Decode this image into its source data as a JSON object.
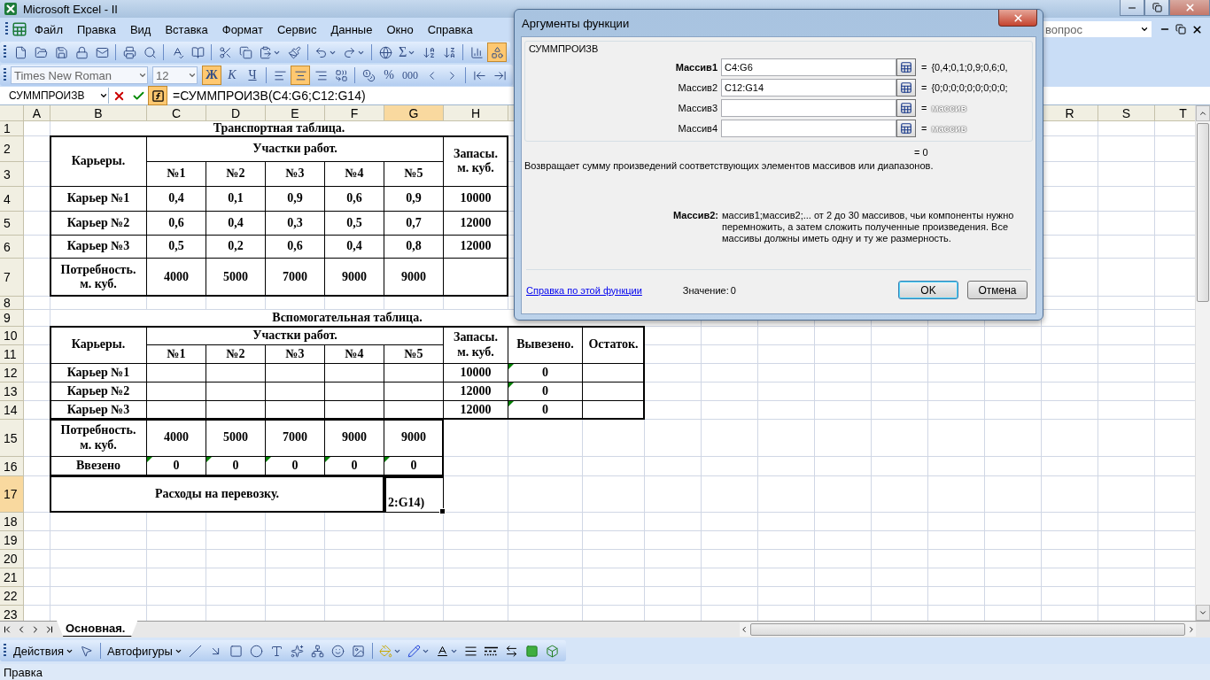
{
  "window": {
    "title": "Microsoft Excel - II"
  },
  "menu": [
    "Файл",
    "Правка",
    "Вид",
    "Вставка",
    "Формат",
    "Сервис",
    "Данные",
    "Окно",
    "Справка"
  ],
  "help_box": {
    "placeholder": "вопрос"
  },
  "standard_toolbar": [
    {
      "kind": "new",
      "on": false
    },
    {
      "kind": "open",
      "on": false
    },
    {
      "kind": "save",
      "on": false
    },
    {
      "kind": "permission",
      "on": false
    },
    {
      "kind": "email",
      "on": false
    },
    {
      "kind": "print",
      "on": false
    },
    {
      "kind": "preview",
      "on": false
    },
    {
      "kind": "spelling",
      "on": false
    },
    {
      "kind": "research",
      "on": false
    },
    {
      "kind": "cut",
      "on": false
    },
    {
      "kind": "copy",
      "on": false
    },
    {
      "kind": "paste",
      "on": false
    },
    {
      "kind": "painter",
      "on": false
    },
    {
      "kind": "undo",
      "on": false
    },
    {
      "kind": "redo",
      "on": false
    },
    {
      "kind": "hyperlink",
      "on": false
    },
    {
      "kind": "autosum",
      "label": "Σ",
      "on": false
    },
    {
      "kind": "sort-asc",
      "on": false
    },
    {
      "kind": "sort-desc",
      "on": false
    },
    {
      "kind": "chart",
      "on": false
    },
    {
      "kind": "drawing",
      "on": true
    }
  ],
  "formatting_toolbar": {
    "font": "Times New Roman",
    "size": "12",
    "buttons": [
      {
        "kind": "bold",
        "label": "Ж",
        "on": true
      },
      {
        "kind": "italic",
        "label": "К",
        "on": false
      },
      {
        "kind": "underline",
        "label": "Ч",
        "on": false
      },
      {
        "kind": "align-left",
        "on": false
      },
      {
        "kind": "align-center",
        "on": true
      },
      {
        "kind": "align-right",
        "on": false
      },
      {
        "kind": "merge",
        "on": false
      },
      {
        "kind": "currency",
        "on": false
      },
      {
        "kind": "percent",
        "label": "%",
        "on": false
      },
      {
        "kind": "thousands",
        "label": "000",
        "on": false
      },
      {
        "kind": "inc-decimal",
        "on": false
      },
      {
        "kind": "dec-decimal",
        "on": false
      },
      {
        "kind": "outdent",
        "on": false
      },
      {
        "kind": "indent",
        "on": false
      }
    ]
  },
  "formula_bar": {
    "name_box": "СУММПРОИЗВ",
    "formula": "=СУММПРОИЗВ(C4:G6;C12:G14)"
  },
  "column_headers": [
    {
      "label": "A",
      "selected": false
    },
    {
      "label": "B",
      "selected": false
    },
    {
      "label": "C",
      "selected": false
    },
    {
      "label": "D",
      "selected": false
    },
    {
      "label": "E",
      "selected": false
    },
    {
      "label": "F",
      "selected": false
    },
    {
      "label": "G",
      "selected": true
    },
    {
      "label": "H",
      "selected": false
    },
    {
      "label": "R",
      "selected": false
    },
    {
      "label": "S",
      "selected": false
    },
    {
      "label": "T",
      "selected": false
    }
  ],
  "row_numbers": [
    {
      "label": "1",
      "selected": false
    },
    {
      "label": "2",
      "selected": false
    },
    {
      "label": "3",
      "selected": false
    },
    {
      "label": "4",
      "selected": false
    },
    {
      "label": "5",
      "selected": false
    },
    {
      "label": "6",
      "selected": false
    },
    {
      "label": "7",
      "selected": false
    },
    {
      "label": "8",
      "selected": false
    },
    {
      "label": "9",
      "selected": false
    },
    {
      "label": "10",
      "selected": false
    },
    {
      "label": "11",
      "selected": false
    },
    {
      "label": "12",
      "selected": false
    },
    {
      "label": "13",
      "selected": false
    },
    {
      "label": "14",
      "selected": false
    },
    {
      "label": "15",
      "selected": false
    },
    {
      "label": "16",
      "selected": false
    },
    {
      "label": "17",
      "selected": true
    },
    {
      "label": "18",
      "selected": false
    },
    {
      "label": "19",
      "selected": false
    },
    {
      "label": "20",
      "selected": false
    },
    {
      "label": "21",
      "selected": false
    },
    {
      "label": "22",
      "selected": false
    },
    {
      "label": "23",
      "selected": false
    }
  ],
  "transport_table": {
    "title": "Транспортная таблица.",
    "corner": "Карьеры.",
    "sites_header": "Участки работ.",
    "stock_header": "Запасы. м. куб.",
    "sites": [
      "№1",
      "№2",
      "№3",
      "№4",
      "№5"
    ],
    "rows": [
      {
        "name": "Карьер №1",
        "values": [
          "0,4",
          "0,1",
          "0,9",
          "0,6",
          "0,9"
        ],
        "stock": "10000"
      },
      {
        "name": "Карьер №2",
        "values": [
          "0,6",
          "0,4",
          "0,3",
          "0,5",
          "0,7"
        ],
        "stock": "12000"
      },
      {
        "name": "Карьер №3",
        "values": [
          "0,5",
          "0,2",
          "0,6",
          "0,4",
          "0,8"
        ],
        "stock": "12000"
      }
    ],
    "demand": {
      "label": "Потребность. м. куб.",
      "values": [
        "4000",
        "5000",
        "7000",
        "9000",
        "9000"
      ]
    }
  },
  "aux_table": {
    "title": "Вспомогательная таблица.",
    "corner": "Карьеры.",
    "sites_header": "Участки работ.",
    "sites": [
      "№1",
      "№2",
      "№3",
      "№4",
      "№5"
    ],
    "stock_header": "Запасы. м. куб.",
    "shipped_header": "Вывезено.",
    "remainder_header": "Остаток.",
    "rows": [
      {
        "name": "Карьер №1",
        "stock": "10000",
        "shipped": "0",
        "flagged": true
      },
      {
        "name": "Карьер №2",
        "stock": "12000",
        "shipped": "0",
        "flagged": true
      },
      {
        "name": "Карьер №3",
        "stock": "12000",
        "shipped": "0",
        "flagged": true
      }
    ],
    "demand": {
      "label": "Потребность. м. куб.",
      "values": [
        "4000",
        "5000",
        "7000",
        "9000",
        "9000"
      ]
    },
    "imported": {
      "label": "Ввезено",
      "values": [
        {
          "text": "0",
          "flagged": true
        },
        {
          "text": "0",
          "flagged": true
        },
        {
          "text": "0",
          "flagged": true
        },
        {
          "text": "0",
          "flagged": true
        },
        {
          "text": "0",
          "flagged": true
        }
      ]
    },
    "costs": {
      "label": "Расходы на перевозку.",
      "value": "2:G14)",
      "selected": true
    }
  },
  "sheet_tabs": [
    {
      "label": "Основная.",
      "selected": true
    }
  ],
  "drawing_toolbar": {
    "actions": "Действия",
    "autoshapes": "Автофигуры"
  },
  "status_bar": "Правка",
  "dialog": {
    "title": "Аргументы функции",
    "function": "СУММПРОИЗВ",
    "arguments": [
      {
        "label": "Массив1",
        "required": true,
        "value": "C4:G6",
        "equals": "=",
        "result": "{0,4;0,1;0,9;0,6;0,"
      },
      {
        "label": "Массив2",
        "required": false,
        "value": "C12:G14",
        "equals": "=",
        "result": "{0;0;0;0;0;0;0;0;0;"
      },
      {
        "label": "Массив3",
        "required": false,
        "equals": "=",
        "hint": "массив"
      },
      {
        "label": "Массив4",
        "required": false,
        "equals": "=",
        "hint": "массив"
      }
    ],
    "formula_result": "= 0",
    "description": "Возвращает сумму произведений соответствующих элементов массивов или диапазонов.",
    "argument_help": {
      "label": "Массив2:",
      "text": "массив1;массив2;... от 2 до 30 массивов, чьи компоненты нужно перемножить, а затем сложить полученные произведения. Все массивы должны иметь одну и ту же размерность."
    },
    "help_link": "Справка по этой функции",
    "value_label": "Значение:",
    "value": "0",
    "buttons": [
      {
        "label": "OK",
        "default": true
      },
      {
        "label": "Отмена",
        "default": false
      }
    ]
  }
}
